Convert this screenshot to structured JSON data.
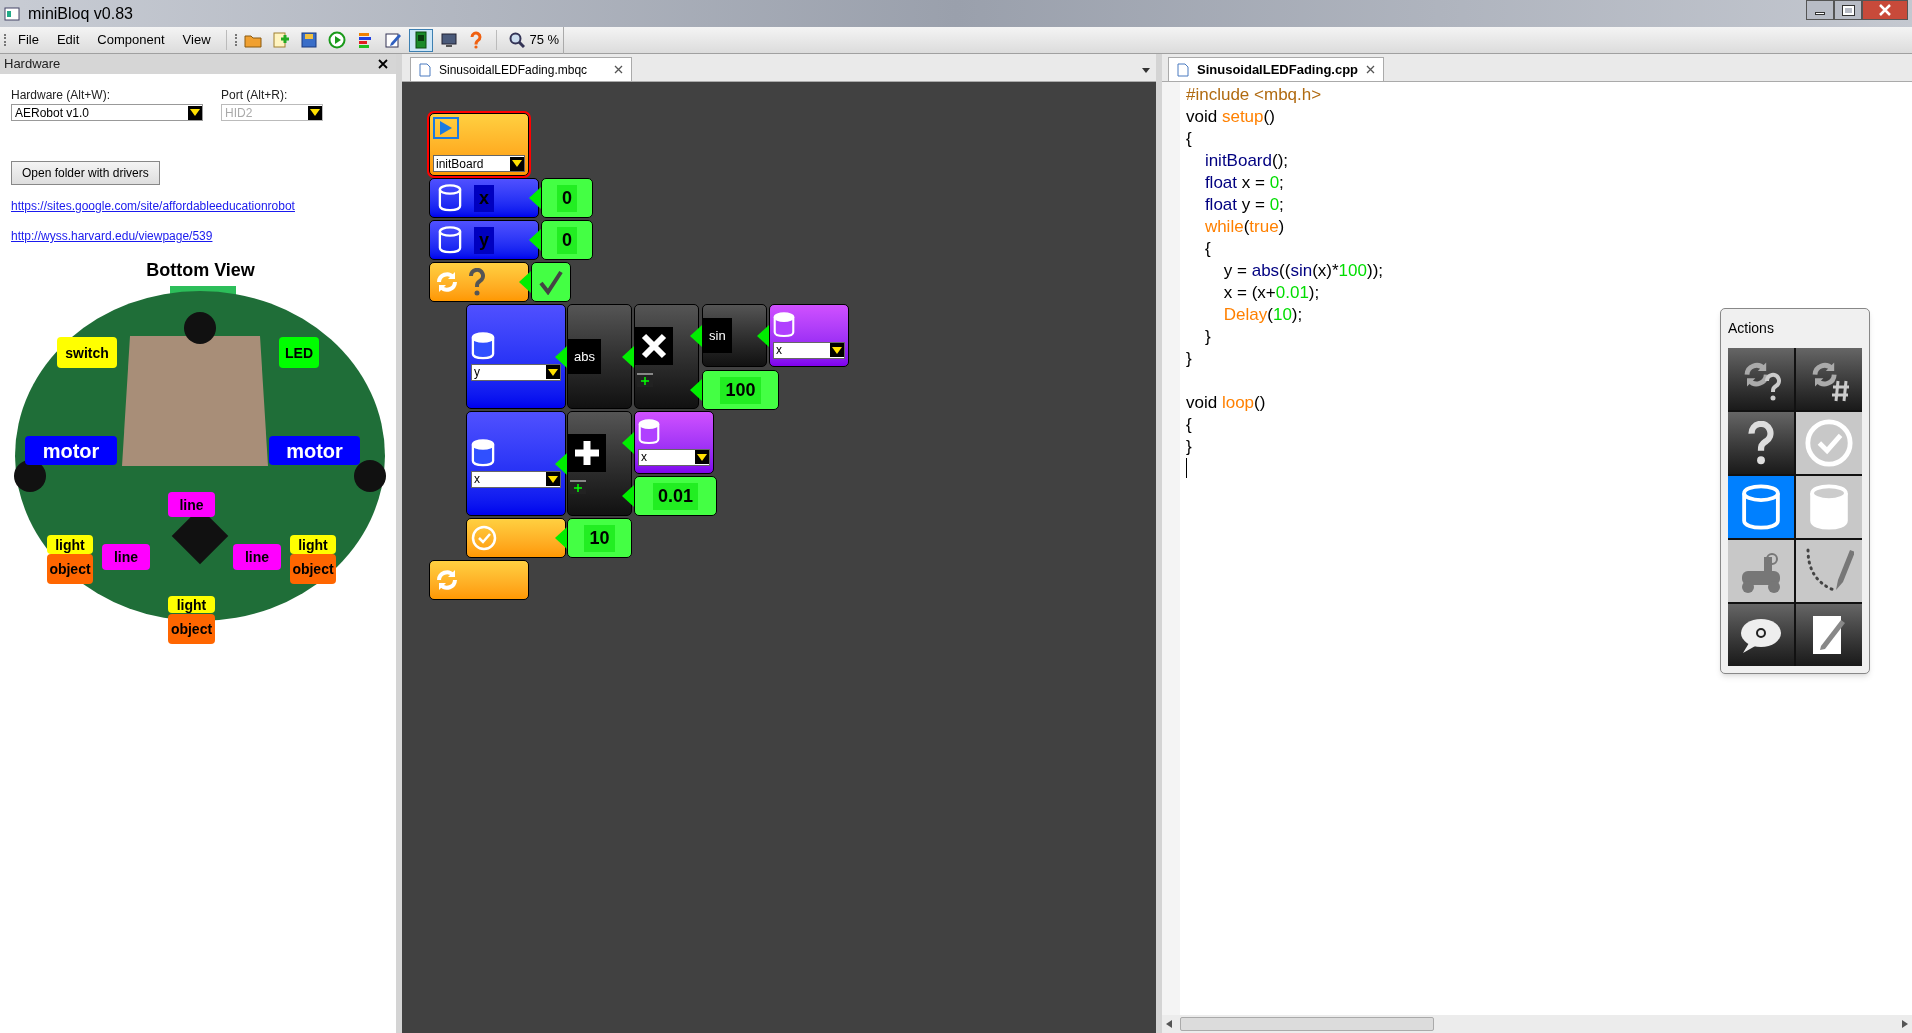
{
  "window": {
    "title": "miniBloq v0.83"
  },
  "menu": [
    "File",
    "Edit",
    "Component",
    "View"
  ],
  "toolbar": [
    {
      "kind": "open",
      "selected": false
    },
    {
      "kind": "new",
      "selected": false
    },
    {
      "kind": "save",
      "selected": false
    },
    {
      "kind": "run",
      "selected": false
    },
    {
      "kind": "blocks",
      "selected": false
    },
    {
      "kind": "edit",
      "selected": false
    },
    {
      "kind": "board",
      "selected": true
    },
    {
      "kind": "monitor",
      "selected": false
    },
    {
      "kind": "help",
      "selected": false
    }
  ],
  "zoom": "75 %",
  "hardware_panel": {
    "title": "Hardware",
    "hardware_label": "Hardware (Alt+W):",
    "hardware_value": "AERobot v1.0",
    "port_label": "Port (Alt+R):",
    "port_value": "HID2",
    "button": "Open folder with drivers",
    "links": [
      "https://sites.google.com/site/affordableeducationrobot",
      "http://wyss.harvard.edu/viewpage/539"
    ],
    "view_title": "Bottom View",
    "parts": [
      {
        "label": "switch",
        "color": "#ffff00"
      },
      {
        "label": "LED",
        "color": "#00ff00"
      },
      {
        "label": "motor",
        "color": "#0000ff"
      },
      {
        "label": "motor",
        "color": "#0000ff"
      },
      {
        "label": "line",
        "color": "#ff00ff"
      },
      {
        "label": "light",
        "color": "#ffff00"
      },
      {
        "label": "object",
        "color": "#ff6600"
      },
      {
        "label": "line",
        "color": "#ff00ff"
      },
      {
        "label": "line",
        "color": "#ff00ff"
      },
      {
        "label": "light",
        "color": "#ffff00"
      },
      {
        "label": "object",
        "color": "#ff6600"
      },
      {
        "label": "light",
        "color": "#ffff00"
      },
      {
        "label": "object",
        "color": "#ff6600"
      }
    ]
  },
  "canvas": {
    "tab": "SinusoidalLEDFading.mbqc",
    "blocks": [
      {
        "kind": "start",
        "value": "initBoard"
      },
      {
        "kind": "variable",
        "value": "x"
      },
      {
        "kind": "number",
        "value": "0"
      },
      {
        "kind": "variable",
        "value": "y"
      },
      {
        "kind": "number",
        "value": "0"
      },
      {
        "kind": "while"
      },
      {
        "kind": "boolean"
      },
      {
        "kind": "assign",
        "value": "y"
      },
      {
        "kind": "function",
        "value": "abs"
      },
      {
        "kind": "multiply"
      },
      {
        "kind": "function",
        "value": "sin"
      },
      {
        "kind": "read",
        "value": "x"
      },
      {
        "kind": "number",
        "value": "100"
      },
      {
        "kind": "assign",
        "value": "x"
      },
      {
        "kind": "add"
      },
      {
        "kind": "read",
        "value": "x"
      },
      {
        "kind": "number",
        "value": "0.01"
      },
      {
        "kind": "delay"
      },
      {
        "kind": "number",
        "value": "10"
      },
      {
        "kind": "loop"
      }
    ]
  },
  "code": {
    "tab": "SinusoidalLEDFading.cpp",
    "sections": [
      [
        [
          {
            "kind": "directive",
            "text": "#include <mbq.h>"
          }
        ],
        [
          {
            "kind": "plain",
            "text": "void "
          },
          {
            "kind": "function",
            "text": "setup"
          },
          {
            "kind": "plain",
            "text": "()"
          }
        ],
        [
          {
            "kind": "plain",
            "text": "{"
          }
        ],
        [
          {
            "kind": "call",
            "text": "    initBoard"
          },
          {
            "kind": "plain",
            "text": "();"
          }
        ],
        [
          {
            "kind": "call",
            "text": "    float"
          },
          {
            "kind": "plain",
            "text": " x = "
          },
          {
            "kind": "number",
            "text": "0"
          },
          {
            "kind": "plain",
            "text": ";"
          }
        ],
        [
          {
            "kind": "call",
            "text": "    float"
          },
          {
            "kind": "plain",
            "text": " y = "
          },
          {
            "kind": "number",
            "text": "0"
          },
          {
            "kind": "plain",
            "text": ";"
          }
        ],
        [
          {
            "kind": "function",
            "text": "    while"
          },
          {
            "kind": "plain",
            "text": "("
          },
          {
            "kind": "function",
            "text": "true"
          },
          {
            "kind": "plain",
            "text": ")"
          }
        ],
        [
          {
            "kind": "plain",
            "text": "    {"
          }
        ],
        [
          {
            "kind": "plain",
            "text": "        y = "
          },
          {
            "kind": "call",
            "text": "abs"
          },
          {
            "kind": "plain",
            "text": "(("
          },
          {
            "kind": "call",
            "text": "sin"
          },
          {
            "kind": "plain",
            "text": "(x)*"
          },
          {
            "kind": "number",
            "text": "100"
          },
          {
            "kind": "plain",
            "text": "));"
          }
        ],
        [
          {
            "kind": "plain",
            "text": "        x = (x+"
          },
          {
            "kind": "number",
            "text": "0.01"
          },
          {
            "kind": "plain",
            "text": ");"
          }
        ],
        [
          {
            "kind": "function",
            "text": "        Delay"
          },
          {
            "kind": "plain",
            "text": "("
          },
          {
            "kind": "number",
            "text": "10"
          },
          {
            "kind": "plain",
            "text": ");"
          }
        ],
        [
          {
            "kind": "plain",
            "text": "    }"
          }
        ],
        [
          {
            "kind": "plain",
            "text": "}"
          }
        ]
      ],
      [
        [
          {
            "kind": "plain",
            "text": "void "
          },
          {
            "kind": "function",
            "text": "loop"
          },
          {
            "kind": "plain",
            "text": "()"
          }
        ],
        [
          {
            "kind": "plain",
            "text": "{"
          }
        ],
        [
          {
            "kind": "plain",
            "text": "}"
          }
        ]
      ]
    ]
  },
  "actions": {
    "title": "Actions",
    "items": [
      {
        "kind": "loop-condition",
        "selected": false
      },
      {
        "kind": "loop-count",
        "selected": false
      },
      {
        "kind": "if",
        "selected": false
      },
      {
        "kind": "delay",
        "selected": false
      },
      {
        "kind": "variable-set",
        "selected": true
      },
      {
        "kind": "variable-get",
        "selected": false
      },
      {
        "kind": "robot",
        "selected": false
      },
      {
        "kind": "draw",
        "selected": false
      },
      {
        "kind": "comment",
        "selected": false
      },
      {
        "kind": "note",
        "selected": false
      }
    ]
  }
}
